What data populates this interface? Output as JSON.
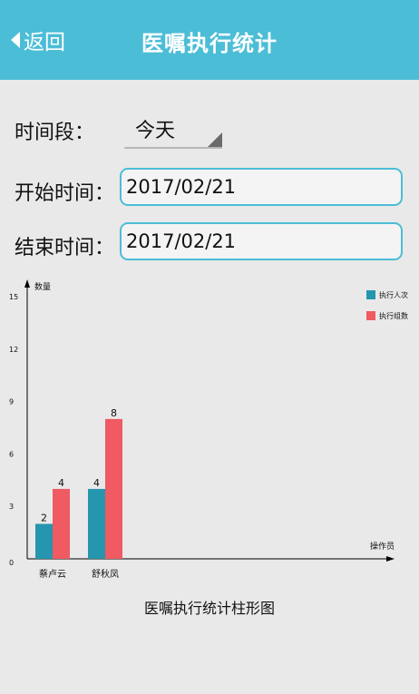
{
  "header": {
    "back_label": "返回",
    "title": "医嘱执行统计"
  },
  "form": {
    "period_label": "时间段：",
    "period_value": "今天",
    "start_label": "开始时间：",
    "start_value": "2017/02/21",
    "end_label": "结束时间：",
    "end_value": "2017/02/21"
  },
  "chart_data": {
    "type": "bar",
    "categories": [
      "蔡卢云",
      "舒秋凤"
    ],
    "series": [
      {
        "name": "执行人次",
        "values": [
          2,
          4
        ],
        "color": "#2596ae"
      },
      {
        "name": "执行组数",
        "values": [
          4,
          8
        ],
        "color": "#ef5a63"
      }
    ],
    "ylabel": "数量",
    "xlabel": "操作员",
    "ylim": [
      0,
      15
    ],
    "yticks": [
      0,
      3,
      6,
      9,
      12,
      15
    ],
    "legend": "top-right",
    "grid": false,
    "caption": "医嘱执行统计柱形图"
  }
}
